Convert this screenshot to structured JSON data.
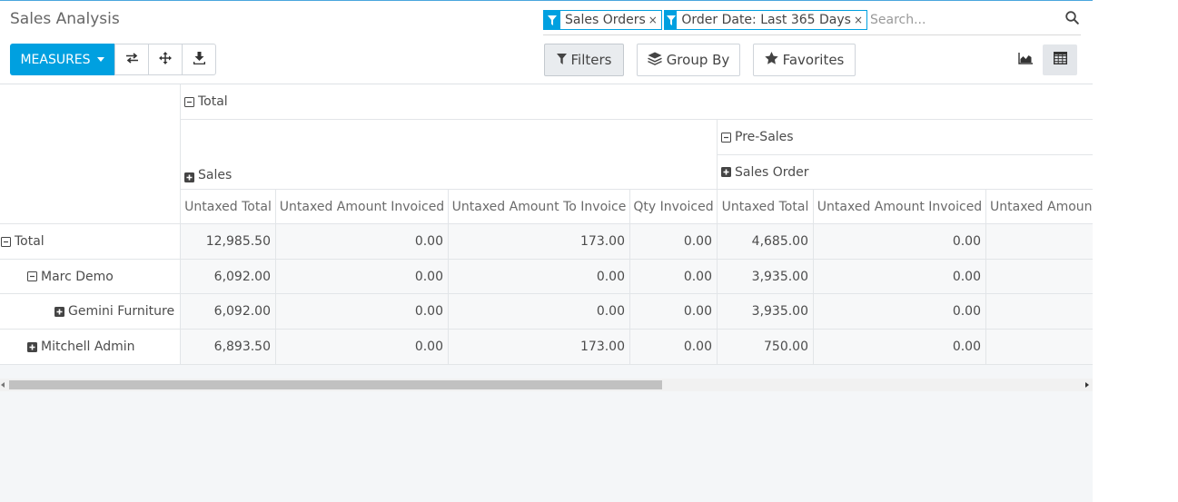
{
  "header": {
    "title": "Sales Analysis"
  },
  "search": {
    "facets": [
      {
        "label": "Sales Orders",
        "remove": "×"
      },
      {
        "label": "Order Date: Last 365 Days",
        "remove": "×"
      }
    ],
    "placeholder": "Search..."
  },
  "toolbar": {
    "measures_label": "MEASURES",
    "filters_label": "Filters",
    "groupby_label": "Group By",
    "favorites_label": "Favorites"
  },
  "pivot": {
    "col_total": "Total",
    "col_group_sales": "Sales",
    "col_group_presales": "Pre-Sales",
    "col_sub_sales_order": "Sales Order",
    "measures": [
      "Untaxed Total",
      "Untaxed Amount Invoiced",
      "Untaxed Amount To Invoice",
      "Qty Invoiced",
      "Untaxed Total",
      "Untaxed Amount Invoiced",
      "Untaxed Amount To Invoice"
    ],
    "rows": [
      {
        "label": "Total",
        "values": [
          "12,985.50",
          "0.00",
          "173.00",
          "0.00",
          "4,685.00",
          "0.00",
          ""
        ]
      },
      {
        "label": "Marc Demo",
        "values": [
          "6,092.00",
          "0.00",
          "0.00",
          "0.00",
          "3,935.00",
          "0.00",
          ""
        ]
      },
      {
        "label": "Gemini Furniture",
        "values": [
          "6,092.00",
          "0.00",
          "0.00",
          "0.00",
          "3,935.00",
          "0.00",
          ""
        ]
      },
      {
        "label": "Mitchell Admin",
        "values": [
          "6,893.50",
          "0.00",
          "173.00",
          "0.00",
          "750.00",
          "0.00",
          ""
        ]
      }
    ]
  },
  "colors": {
    "accent": "#00a0e0",
    "background": "#f4f6f8"
  }
}
